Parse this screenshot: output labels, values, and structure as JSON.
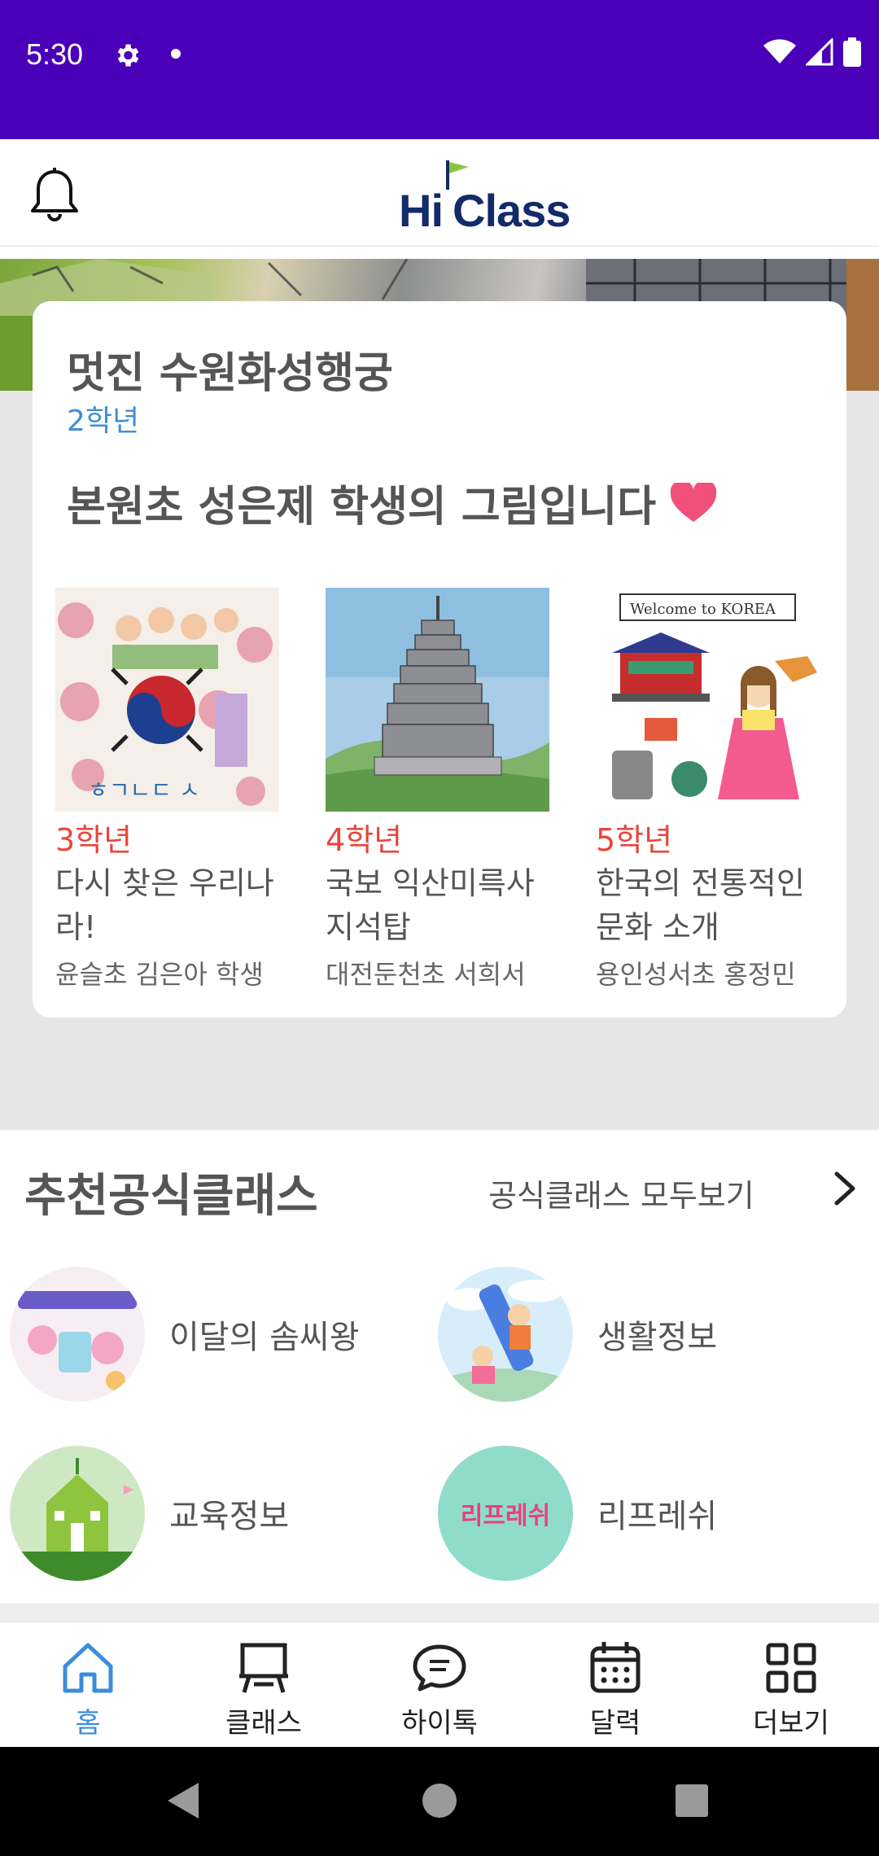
{
  "status_bar": {
    "time": "5:30"
  },
  "header": {
    "logo_hi": "Hi",
    "logo_class": "Class"
  },
  "featured": {
    "title": "멋진 수원화성행궁",
    "grade": "2학년",
    "subtitle": "본원초 성은제 학생의 그림입니다",
    "artworks": [
      {
        "grade": "3학년",
        "title": "다시 찾은 우리나라!",
        "school": "윤슬초 김은아 학생"
      },
      {
        "grade": "4학년",
        "title": "국보 익산미륵사지석탑",
        "school": "대전둔천초 서희서"
      },
      {
        "grade": "5학년",
        "title": "한국의 전통적인 문화 소개",
        "school": "용인성서초 홍정민"
      }
    ]
  },
  "recommended": {
    "title": "추천공식클래스",
    "see_all": "공식클래스 모두보기",
    "items": [
      {
        "label": "이달의 솜씨왕",
        "icon": "monthly-talent-thumbnail"
      },
      {
        "label": "생활정보",
        "icon": "life-info-thumbnail"
      },
      {
        "label": "교육정보",
        "icon": "education-info-thumbnail"
      },
      {
        "label": "리프레쉬",
        "icon": "refresh-thumbnail",
        "thumb_text": "리프레쉬"
      }
    ]
  },
  "bottom_nav": [
    {
      "label": "홈",
      "icon": "home-icon",
      "active": true
    },
    {
      "label": "클래스",
      "icon": "class-board-icon"
    },
    {
      "label": "하이톡",
      "icon": "chat-icon"
    },
    {
      "label": "달력",
      "icon": "calendar-icon"
    },
    {
      "label": "더보기",
      "icon": "grid-icon"
    }
  ],
  "colors": {
    "status_bar": "#4a00b8",
    "accent_blue": "#3f8fd6",
    "grade_red": "#e8453a",
    "heart": "#f0507a",
    "logo_navy": "#132a6b"
  }
}
